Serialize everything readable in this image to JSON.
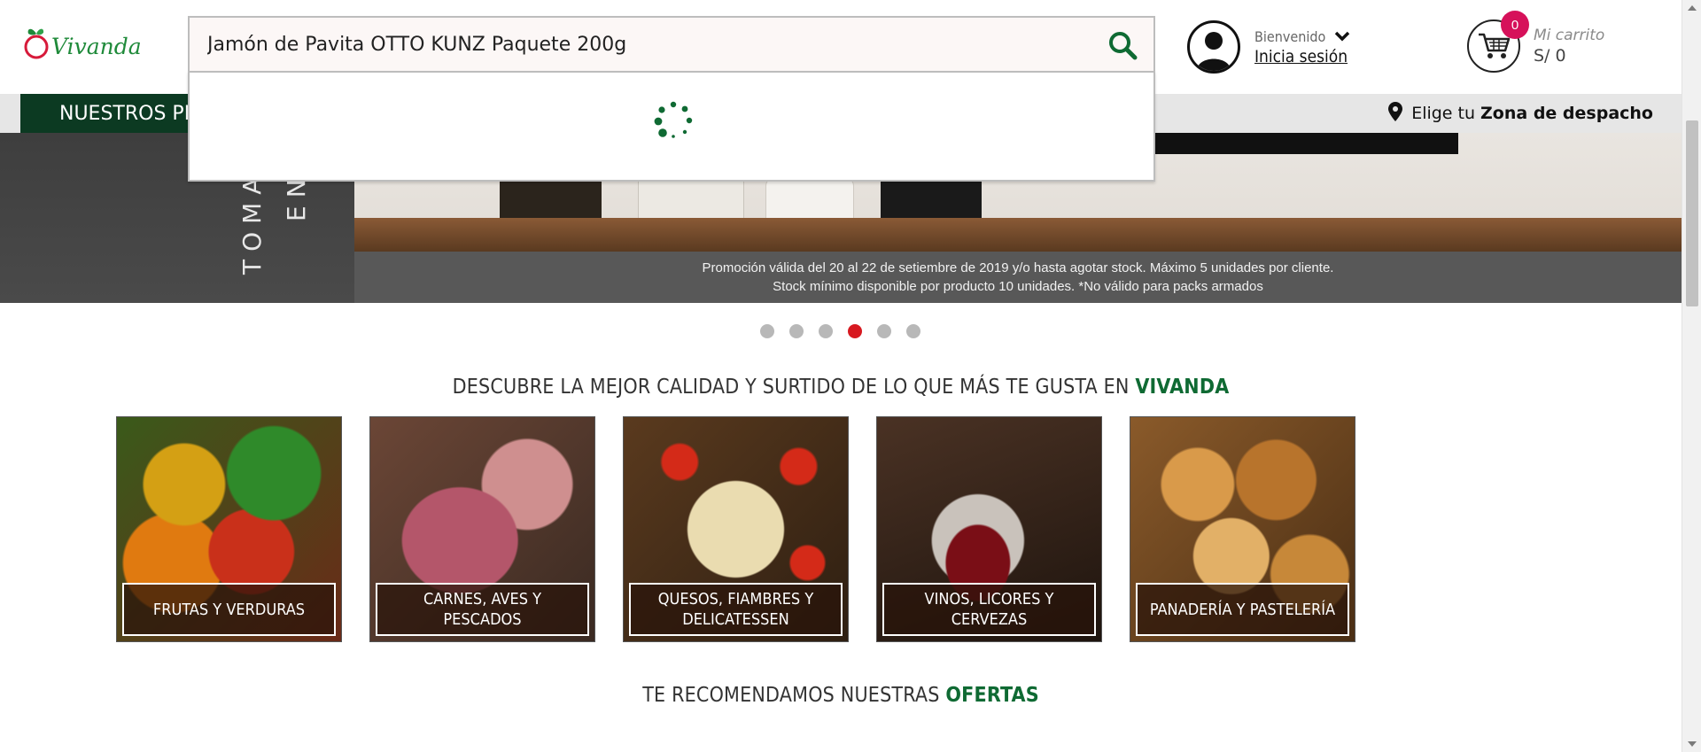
{
  "brand": {
    "name": "Vivanda",
    "color": "#1f8a3a"
  },
  "search": {
    "value": "Jamón de Pavita OTTO KUNZ Paquete 200g",
    "button_icon": "search-icon",
    "loading": true
  },
  "user": {
    "welcome": "Bienvenido",
    "login_label": "Inicia sesión",
    "avatar_icon": "user-avatar-icon"
  },
  "cart": {
    "count": "0",
    "label": "Mi carrito",
    "total": "S/ 0",
    "icon": "shopping-cart-icon"
  },
  "nav": {
    "products_label": "NUESTROS PRODUCTOS",
    "zone_prefix": "Elige tu",
    "zone_bold": "Zona de despacho"
  },
  "banner": {
    "vertical_text_1": "TOMAR",
    "vertical_text_2": "EN",
    "promo_line_1": "Promoción válida del 20 al 22 de setiembre de 2019 y/o hasta agotar stock. Máximo 5 unidades por cliente.",
    "promo_line_2": "Stock mínimo disponible por producto 10 unidades. *No válido para packs armados",
    "slides": 6,
    "active_slide": 4
  },
  "section_1": {
    "title_prefix": "DESCUBRE LA MEJOR CALIDAD Y SURTIDO DE LO QUE MÁS TE GUSTA EN",
    "title_highlight": "VIVANDA"
  },
  "categories": [
    {
      "label": "FRUTAS Y VERDURAS"
    },
    {
      "label": "CARNES, AVES Y PESCADOS"
    },
    {
      "label": "QUESOS, FIAMBRES Y DELICATESSEN"
    },
    {
      "label": "VINOS, LICORES Y CERVEZAS"
    },
    {
      "label": "PANADERÍA Y PASTELERÍA"
    }
  ],
  "section_2": {
    "title_prefix": "TE RECOMENDAMOS NUESTRAS",
    "title_highlight": "OFERTAS"
  },
  "colors": {
    "accent_green": "#0f6a33",
    "nav_green": "#0c3a22",
    "active_dot": "#d71920",
    "cart_badge": "#d6115a"
  }
}
